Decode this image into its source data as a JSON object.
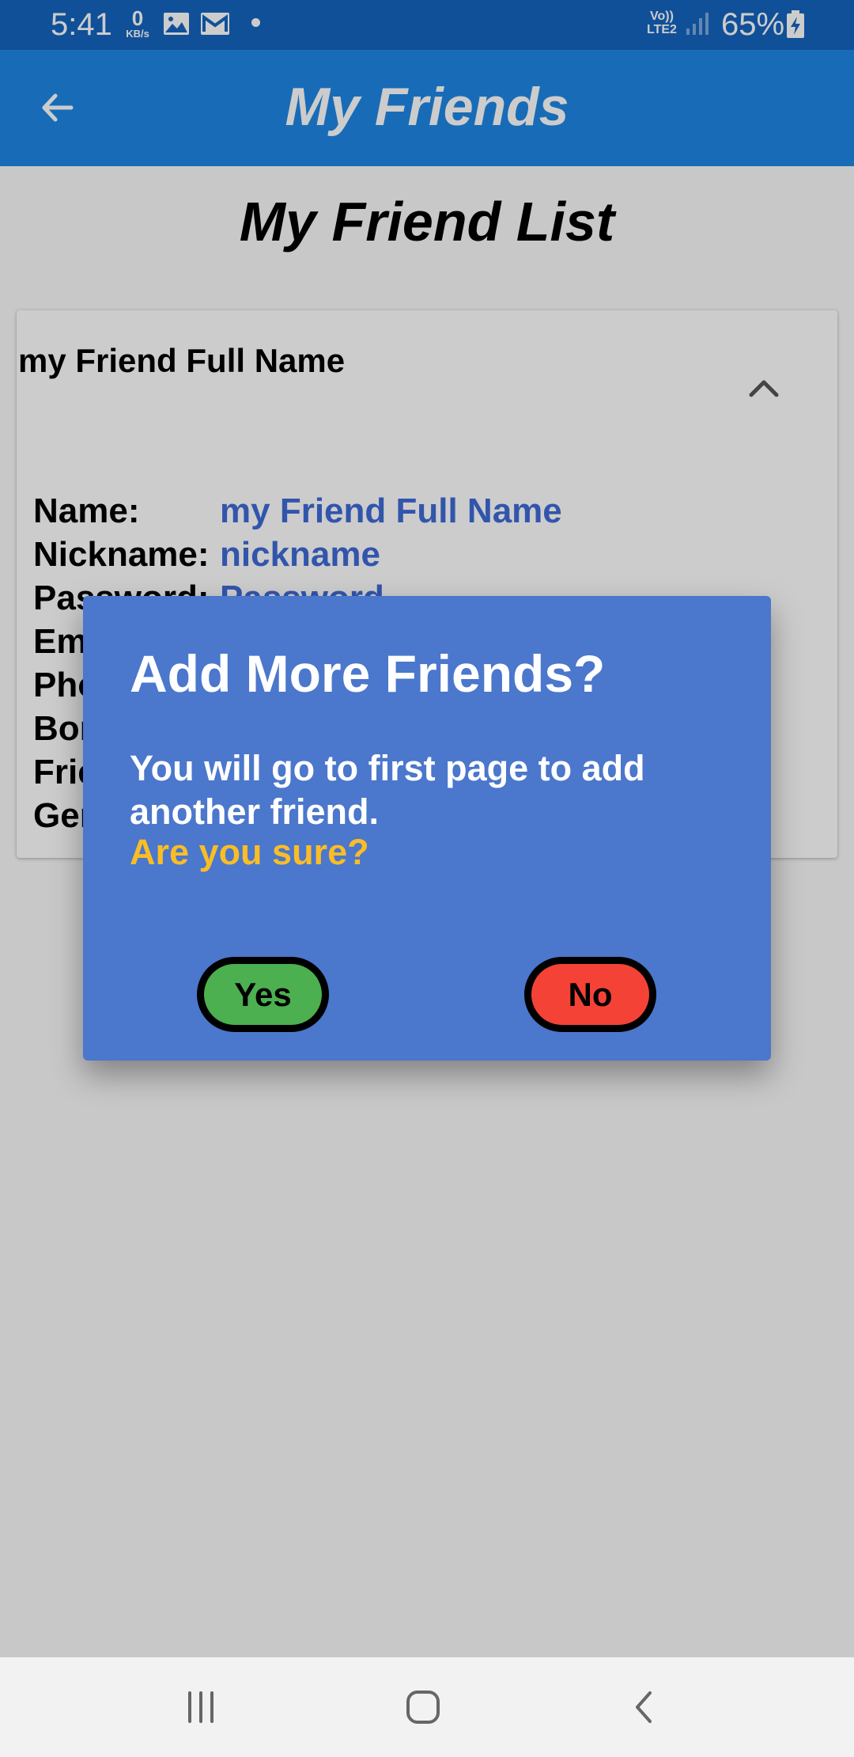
{
  "status_bar": {
    "time": "5:41",
    "net_speed": {
      "value": "0",
      "unit": "KB/s"
    },
    "icons": [
      "image-icon",
      "gmail-icon"
    ],
    "volte": {
      "top": "Vo))",
      "bottom": "LTE2"
    },
    "battery_percent": "65%"
  },
  "app_bar": {
    "title": "My Friends",
    "back_icon": "arrow-back-icon"
  },
  "page": {
    "list_title": "My Friend List"
  },
  "card": {
    "header_name": "my Friend Full Name",
    "expand_icon": "chevron-up-icon",
    "details": [
      {
        "label": "Name:",
        "value": "my Friend Full Name"
      },
      {
        "label": "Nickname:",
        "value": "nickname"
      },
      {
        "label": "Password:",
        "value": "Password"
      },
      {
        "label": "Em",
        "value": ""
      },
      {
        "label": "Pho",
        "value": ""
      },
      {
        "label": "Bor",
        "value": ""
      },
      {
        "label": "Frie",
        "value": ""
      },
      {
        "label": "Ger",
        "value": ""
      }
    ]
  },
  "dialog": {
    "title": "Add More Friends?",
    "body": "You will go to first page to add another friend.",
    "question": "Are you sure?",
    "yes_label": "Yes",
    "no_label": "No"
  },
  "nav_bar": {
    "icons": [
      "recent-apps-icon",
      "home-icon",
      "back-icon"
    ]
  },
  "colors": {
    "status_bar": "#1565c0",
    "app_bar": "#1e88e5",
    "dialog_bg": "#4b77cc",
    "question_text": "#f9bd25",
    "detail_value": "#3f6bd8",
    "yes_button": "#4caf50",
    "no_button": "#f44336"
  }
}
